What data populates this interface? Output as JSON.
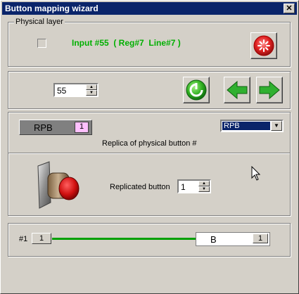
{
  "window": {
    "title": "Button mapping wizard",
    "close_glyph": "✕"
  },
  "physical": {
    "group_label": "Physical layer",
    "input_text": "Input #55  ( Reg#7  Line#7 )",
    "text_color": "#00b000"
  },
  "navigation": {
    "spin_value": "55"
  },
  "replica": {
    "button_label": "RPB",
    "button_badge": "1",
    "select_value": "RPB",
    "caption": "Replica of physical button #",
    "replicated_label": "Replicated button",
    "replicated_value": "1"
  },
  "mapping": {
    "index_label": "#1",
    "left_value": "1",
    "right_label": "B",
    "right_value": "1",
    "line_color": "#00a000"
  }
}
